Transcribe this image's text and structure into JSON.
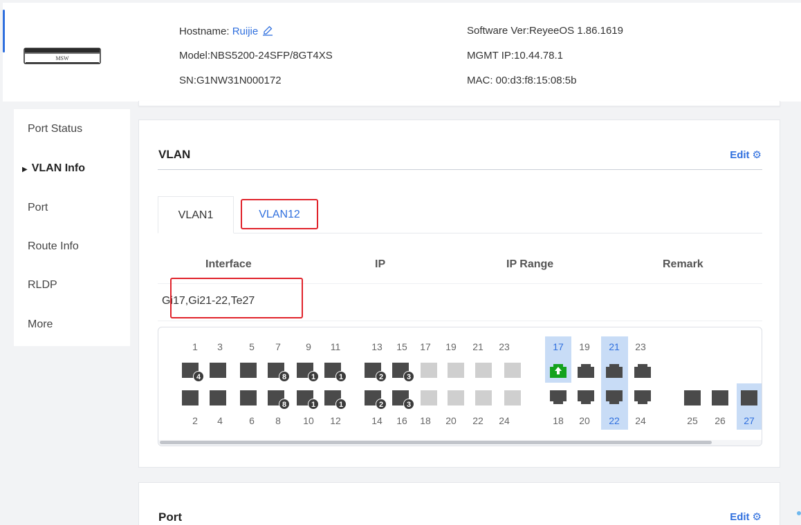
{
  "header": {
    "device_label": "MSW",
    "hostname_label": "Hostname:",
    "hostname_value": "Ruijie",
    "model": "Model:NBS5200-24SFP/8GT4XS",
    "sn": "SN:G1NW31N000172",
    "software": "Software Ver:ReyeeOS 1.86.1619",
    "mgmt_ip": "MGMT IP:10.44.78.1",
    "mac": "MAC: 00:d3:f8:15:08:5b"
  },
  "sidebar": {
    "items": [
      {
        "label": "Port Status",
        "active": false
      },
      {
        "label": "VLAN Info",
        "active": true
      },
      {
        "label": "Port",
        "active": false
      },
      {
        "label": "Route Info",
        "active": false
      },
      {
        "label": "RLDP",
        "active": false
      },
      {
        "label": "More",
        "active": false
      }
    ]
  },
  "vlan": {
    "title": "VLAN",
    "edit_label": "Edit",
    "tabs": [
      {
        "label": "VLAN1",
        "selected": false
      },
      {
        "label": "VLAN12",
        "selected": true
      }
    ],
    "columns": [
      "Interface",
      "IP",
      "IP Range",
      "Remark"
    ],
    "rows": [
      {
        "interface": "Gi17,Gi21-22,Te27",
        "ip": "",
        "ip_range": "",
        "remark": ""
      }
    ]
  },
  "ports": {
    "top_numbers": [
      "1",
      "3",
      "5",
      "7",
      "9",
      "11",
      "13",
      "15",
      "17",
      "19",
      "21",
      "23",
      "17",
      "19",
      "21",
      "23"
    ],
    "bottom_numbers": [
      "2",
      "4",
      "6",
      "8",
      "10",
      "12",
      "14",
      "16",
      "18",
      "20",
      "22",
      "24",
      "18",
      "20",
      "22",
      "24",
      "25",
      "26",
      "27"
    ],
    "badges": [
      "4",
      "8",
      "1",
      "1",
      "2",
      "3",
      "8",
      "1",
      "1",
      "2",
      "3"
    ],
    "selected_ports": [
      "17",
      "21",
      "22",
      "27"
    ],
    "colors": {
      "sfp_active": "#4a4a4a",
      "sfp_inactive": "#cfcfcf",
      "uplink": "#14a21d",
      "selected": "#c8dcf6",
      "accent": "#2f6fde",
      "highlight_box": "#e0222a"
    }
  },
  "port_section": {
    "title": "Port",
    "edit_label": "Edit"
  }
}
